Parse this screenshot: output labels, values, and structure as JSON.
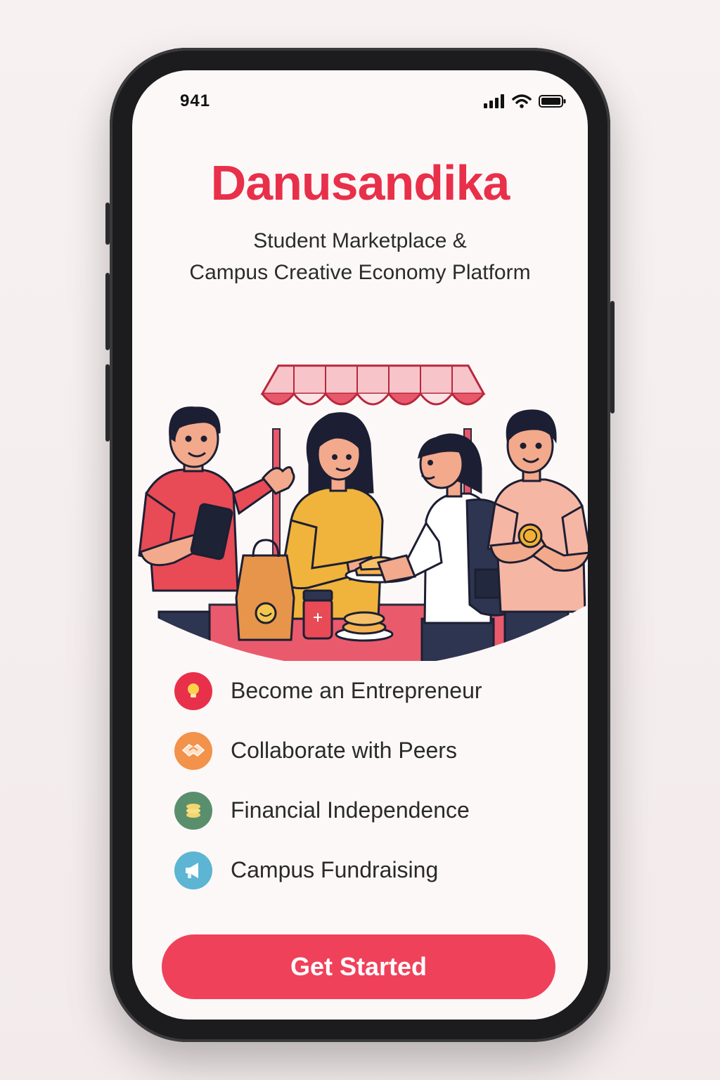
{
  "status_bar": {
    "time": "941"
  },
  "app": {
    "title": "Danusandika",
    "subtitle_line1": "Student Marketplace &",
    "subtitle_line2": "Campus Creative Economy Platform"
  },
  "features": [
    {
      "label": "Become an Entrepreneur",
      "icon": "lightbulb-icon",
      "color": "#e8304a"
    },
    {
      "label": "Collaborate with Peers",
      "icon": "handshake-icon",
      "color": "#f3924a"
    },
    {
      "label": "Financial Independence",
      "icon": "coins-icon",
      "color": "#5a8f6e"
    },
    {
      "label": "Campus Fundraising",
      "icon": "megaphone-icon",
      "color": "#5bb5d3"
    }
  ],
  "cta": {
    "label": "Get Started"
  },
  "colors": {
    "brand": "#e8304a",
    "button": "#f0415b"
  }
}
